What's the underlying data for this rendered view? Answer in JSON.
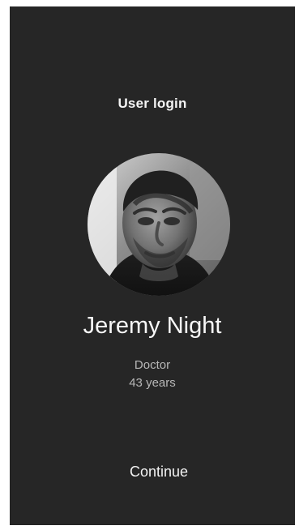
{
  "screen": {
    "title": "User login",
    "avatar": {
      "icon": "user-portrait"
    },
    "profile": {
      "name": "Jeremy Night",
      "role": "Doctor",
      "age": "43 years"
    },
    "continue_label": "Continue"
  },
  "colors": {
    "background": "#262626",
    "text_primary": "#ffffff",
    "text_secondary": "#b7b7b7"
  }
}
